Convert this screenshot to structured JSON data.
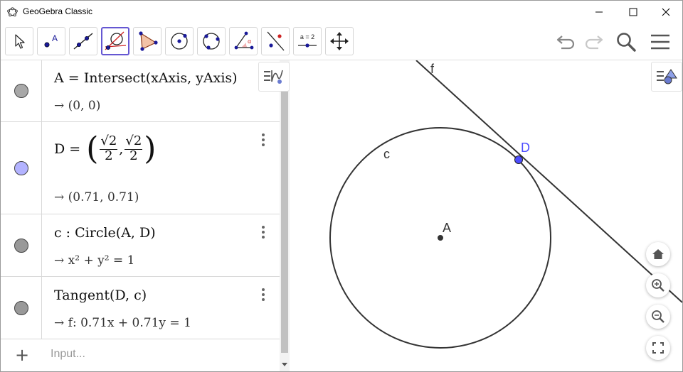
{
  "window": {
    "title": "GeoGebra Classic"
  },
  "toolbar": {
    "tools": [
      "move-tool",
      "point-tool",
      "line-tool",
      "tangents-tool",
      "polygon-tool",
      "circle-center-point-tool",
      "circle-through-three-points-tool",
      "angle-tool",
      "reflect-about-line-tool",
      "slider-tool",
      "move-graphics-view-tool"
    ],
    "slider_label": "a = 2",
    "selected_tool": "tangents-tool"
  },
  "algebra": {
    "rows": [
      {
        "definition": "A = Intersect(xAxis, yAxis)",
        "output": "→ (0, 0)",
        "marble_color": "#a8a8a8"
      },
      {
        "definition_lhs": "D =",
        "sqrt_num": "√2",
        "den": "2",
        "output": "→ (0.71, 0.71)",
        "marble_color": "#b3b3ff"
      },
      {
        "definition": "c : Circle(A, D)",
        "output": "→ x² + y² = 1",
        "marble_color": "#999999"
      },
      {
        "definition": "Tangent(D, c)",
        "output": "→ f: 0.71x + 0.71y = 1",
        "marble_color": "#999999"
      }
    ],
    "input_placeholder": "Input...",
    "add_symbol": "+"
  },
  "graphics": {
    "labels": {
      "point_a": "A",
      "point_d": "D",
      "circle": "c",
      "line": "f"
    },
    "colors": {
      "point_d": "#4d4dff",
      "curve": "#333333",
      "point_a": "#333333"
    }
  }
}
